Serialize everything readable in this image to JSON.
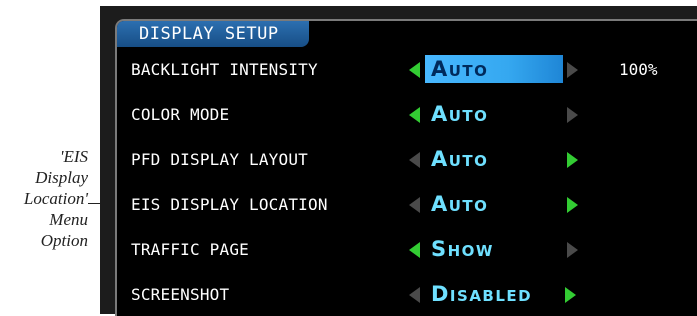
{
  "callout": {
    "lines": [
      "'EIS",
      "Display",
      "Location'",
      "Menu",
      "Option"
    ]
  },
  "window": {
    "title": "DISPLAY SETUP"
  },
  "rows": [
    {
      "label": "BACKLIGHT INTENSITY",
      "value": "Auto",
      "extra": "100%",
      "selected": true,
      "left_arrow_active": true,
      "right_arrow_active": false
    },
    {
      "label": "COLOR MODE",
      "value": "Auto",
      "extra": "",
      "selected": false,
      "left_arrow_active": true,
      "right_arrow_active": false
    },
    {
      "label": "PFD DISPLAY LAYOUT",
      "value": "Auto",
      "extra": "",
      "selected": false,
      "left_arrow_active": false,
      "right_arrow_active": true
    },
    {
      "label": "EIS DISPLAY LOCATION",
      "value": "Auto",
      "extra": "",
      "selected": false,
      "left_arrow_active": false,
      "right_arrow_active": true
    },
    {
      "label": "TRAFFIC PAGE",
      "value": "Show",
      "extra": "",
      "selected": false,
      "left_arrow_active": true,
      "right_arrow_active": false
    },
    {
      "label": "SCREENSHOT",
      "value": "Disabled",
      "extra": "",
      "selected": false,
      "left_arrow_active": false,
      "right_arrow_active": true
    }
  ],
  "colors": {
    "active_arrow": "#33cc33",
    "inactive_arrow": "#4a4a4a",
    "value_text": "#6fe0ff",
    "selection": "#35a8f0",
    "title_bar": "#2c6fb0"
  }
}
